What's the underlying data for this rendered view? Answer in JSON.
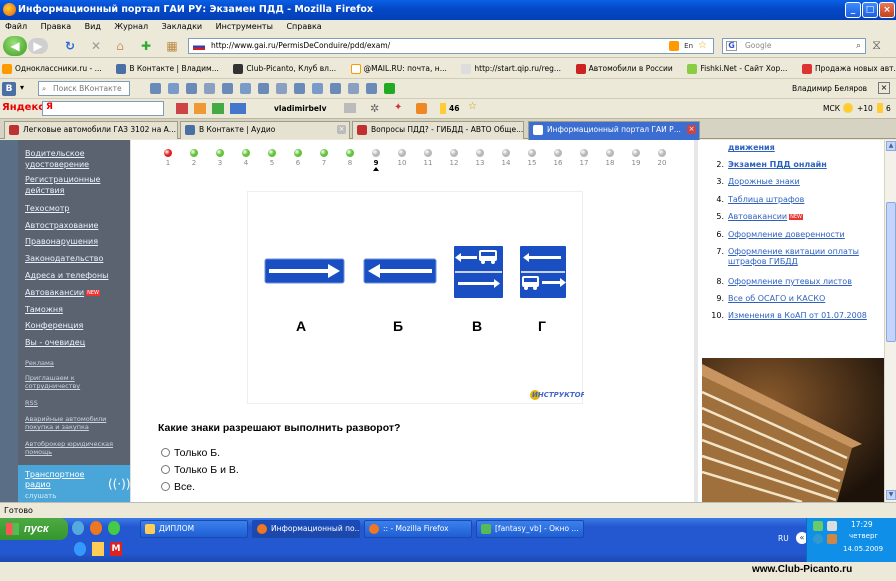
{
  "window": {
    "title": "Информационный портал ГАИ РУ: Экзамен ПДД - Mozilla Firefox"
  },
  "menu": [
    "Файл",
    "Правка",
    "Вид",
    "Журнал",
    "Закладки",
    "Инструменты",
    "Справка"
  ],
  "nav": {
    "url": "http://www.gai.ru/PermisDeConduire/pdd/exam/",
    "search_placeholder": "Google"
  },
  "bookmarks": [
    "Одноклассники.ru - ...",
    "В Контакте | Владим...",
    "Club-Picanto, Клуб вл...",
    "@MAIL.RU: почта, н...",
    "http://start.qip.ru/reg...",
    "Автомобили в России",
    "Fishki.Net - Сайт Хор...",
    "Продажа новых авт..."
  ],
  "vk_toolbar": {
    "search_placeholder": "Поиск ВКонтакте",
    "user": "Владимир Беляров"
  },
  "yandex_toolbar": {
    "logo": "Яндекс",
    "user": "vladimirbelv",
    "mail_count": "46",
    "city": "МСК",
    "temp": "+10",
    "count": "6"
  },
  "tabs": [
    {
      "label": "Легковые автомобили ГАЗ 3102 на А...",
      "active": false,
      "icon_color": "#c03030"
    },
    {
      "label": "В Контакте | Аудио",
      "active": false,
      "icon_color": "#4a6fa5"
    },
    {
      "label": "Вопросы ПДД? - ГИБДД - АВТО Обще...",
      "active": false,
      "icon_color": "#c03030"
    },
    {
      "label": "Информационный портал ГАИ Р...",
      "active": true,
      "icon_color": "#2a6fd8"
    }
  ],
  "sidebar": {
    "items": [
      "Водительское удостоверение",
      "Регистрационные действия",
      "Техосмотр",
      "Автострахование",
      "Правонарушения",
      "Законодательство",
      "Адреса и телефоны",
      "Автовакансии",
      "Таможня",
      "Конференция",
      "Вы - очевидец"
    ],
    "new_label": "NEW",
    "small_links": [
      "Реклама",
      "Приглашаем к сотрудничеству",
      "RSS",
      "Аварийные автомобили покупка и закупка",
      "Автоброкер юридическая помощь"
    ],
    "radio": {
      "line1": "Транспортное",
      "line2": "радио",
      "line3": "слушать"
    }
  },
  "progress": {
    "numbers": [
      "1",
      "2",
      "3",
      "4",
      "5",
      "6",
      "7",
      "8",
      "9",
      "10",
      "11",
      "12",
      "13",
      "14",
      "15",
      "16",
      "17",
      "18",
      "19",
      "20"
    ],
    "states": [
      "red",
      "green",
      "green",
      "green",
      "green",
      "green",
      "green",
      "green",
      "current",
      "gray",
      "gray",
      "gray",
      "gray",
      "gray",
      "gray",
      "gray",
      "gray",
      "gray",
      "gray",
      "gray"
    ]
  },
  "signs": {
    "labels": [
      "А",
      "Б",
      "В",
      "Г"
    ],
    "logo": "ИНСТРУКТОР"
  },
  "question": {
    "text": "Какие знаки разрешают выполнить разворот?",
    "answers": [
      "Только Б.",
      "Только Б и В.",
      "Все."
    ]
  },
  "right_list": [
    {
      "n": "",
      "text": "движения",
      "bold": true
    },
    {
      "n": "2.",
      "text": "Экзамен ПДД онлайн",
      "bold": true
    },
    {
      "n": "3.",
      "text": "Дорожные знаки"
    },
    {
      "n": "4.",
      "text": "Таблица штрафов"
    },
    {
      "n": "5.",
      "text": "Автовакансии",
      "new": true
    },
    {
      "n": "6.",
      "text": "Оформление доверенности"
    },
    {
      "n": "7.",
      "text": "Оформление квитации оплаты штрафов ГИБДД"
    },
    {
      "n": "8.",
      "text": "Оформление путевых листов"
    },
    {
      "n": "9.",
      "text": "Все об ОСАГО и КАСКО"
    },
    {
      "n": "10.",
      "text": "Изменения в КоАП от 01.07.2008"
    }
  ],
  "status": {
    "text": "Готово"
  },
  "taskbar": {
    "start": "пуск",
    "tasks": [
      "ДИПЛОМ",
      "Информационный по...",
      ":: - Mozilla Firefox",
      "[fantasy_vb] - Окно ..."
    ],
    "lang": "RU",
    "time": "17:29",
    "day": "четверг",
    "date": "14.05.2009"
  },
  "watermark": "www.Club-Picanto.ru",
  "colors": {
    "sign_blue": "#1a4fc4",
    "dot_green": "#62c23a",
    "dot_red": "#e02020",
    "dot_gray": "#b8b8b8",
    "link_blue": "#2f62c0"
  }
}
